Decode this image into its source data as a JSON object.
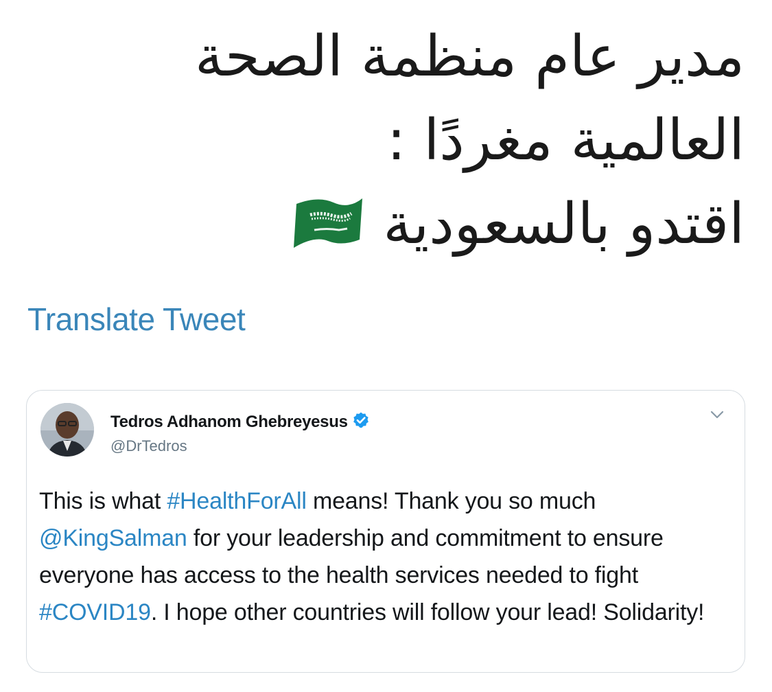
{
  "caption": {
    "line1": "مدير عام منظمة الصحة",
    "line2": "العالمية مغردًا :",
    "line3": "اقتدو بالسعودية",
    "flag_icon": "saudi-flag-icon"
  },
  "translate_label": "Translate Tweet",
  "tweet": {
    "author_name": "Tedros Adhanom Ghebreyesus",
    "handle": "@DrTedros",
    "verified_icon": "verified-badge-icon",
    "menu_icon": "chevron-down-icon",
    "text_1": "This is what ",
    "hashtag_1": "#HealthForAll",
    "text_2": " means! Thank you so much ",
    "mention": "@KingSalman",
    "text_3": " for your leadership and commitment to ensure everyone has access to the health services needed to fight ",
    "hashtag_2": "#COVID19",
    "text_4": ". I hope other countries will follow your lead! Solidarity!"
  },
  "colors": {
    "link": "#2b86c4",
    "translate": "#3a86b9",
    "flag_green": "#1b7a3e",
    "border": "#d6dce1"
  }
}
